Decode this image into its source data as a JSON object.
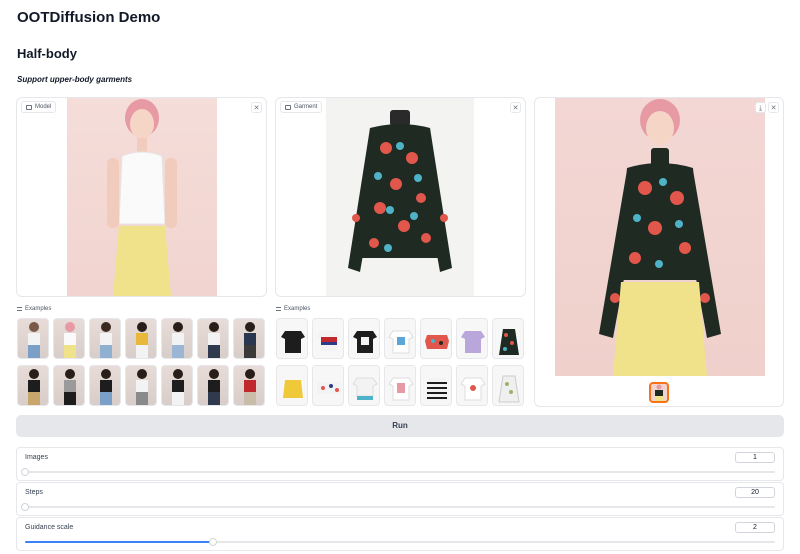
{
  "app": {
    "title": "OOTDiffusion Demo"
  },
  "section": {
    "title": "Half-body",
    "subtitle": "Support upper-body garments"
  },
  "model_panel": {
    "label": "Model"
  },
  "garment_panel": {
    "label": "Garment"
  },
  "model_examples": {
    "label": "Examples"
  },
  "garment_examples": {
    "label": "Examples"
  },
  "run": {
    "label": "Run"
  },
  "sliders": [
    {
      "label": "Images",
      "value": "1",
      "fraction": 0.0
    },
    {
      "label": "Steps",
      "value": "20",
      "fraction": 0.0
    },
    {
      "label": "Guidance scale",
      "value": "2",
      "fraction": 0.25
    }
  ],
  "colors": {
    "accent": "#f97316",
    "slider": "#3b82f6",
    "run_bg": "#e5e7eb"
  },
  "icons": {
    "close": "✕",
    "download": "⤓"
  }
}
